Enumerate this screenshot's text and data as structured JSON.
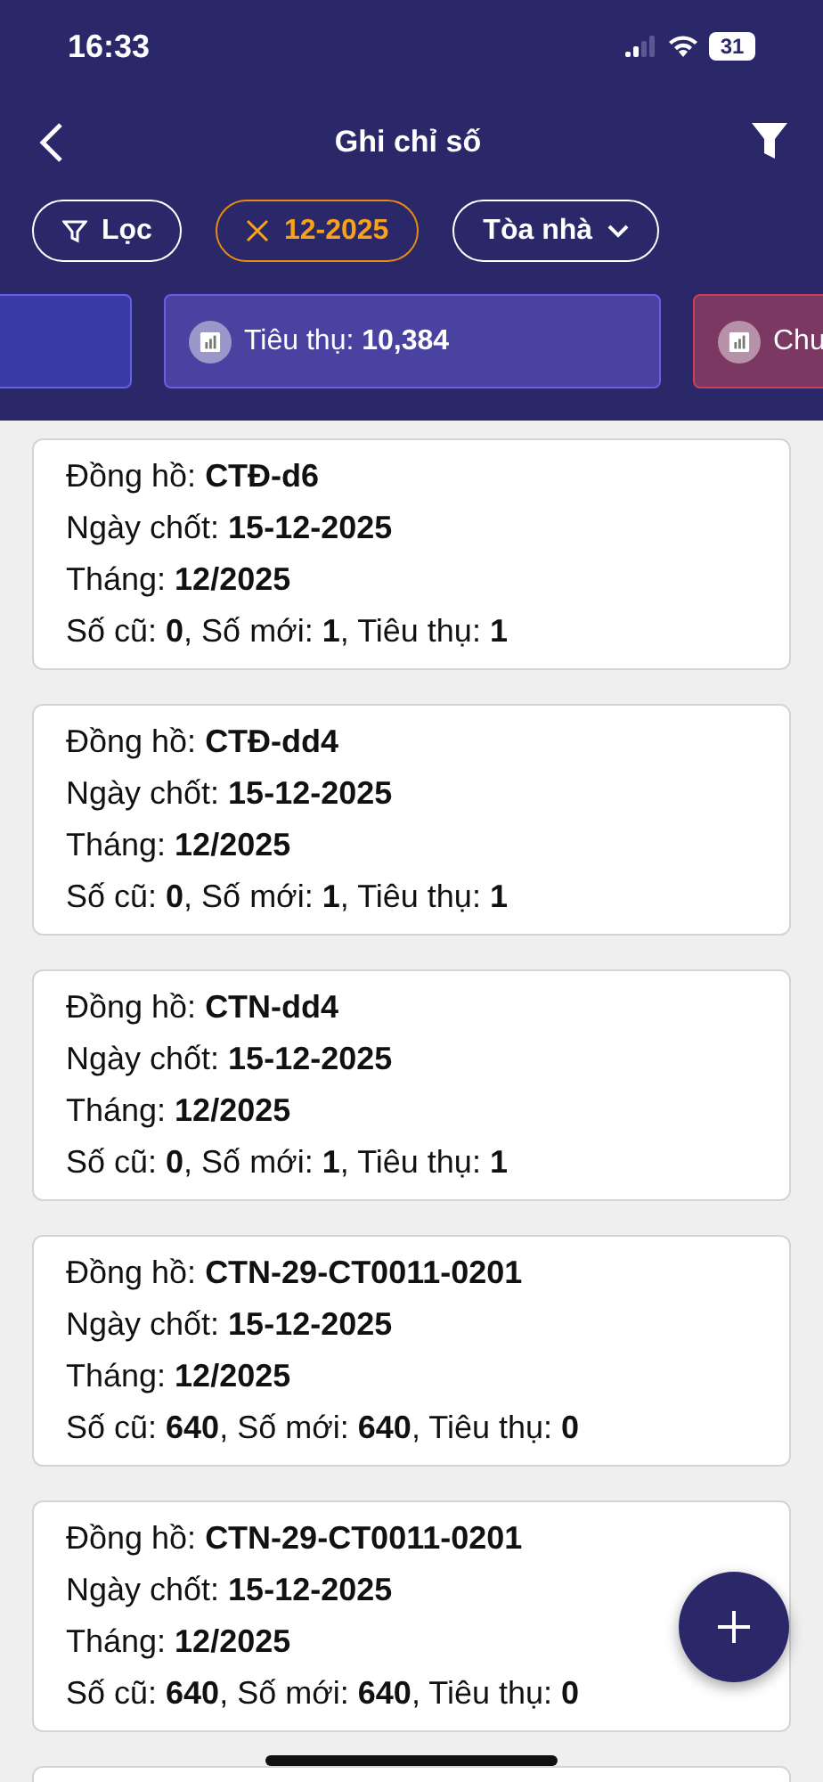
{
  "status_bar": {
    "time": "16:33",
    "battery": "31"
  },
  "header": {
    "title": "Ghi chỉ số"
  },
  "chips": [
    {
      "kind": "filter",
      "label": "Lọc",
      "active": false
    },
    {
      "kind": "clear",
      "label": "12-2025",
      "active": true
    },
    {
      "kind": "dropdown",
      "label": "Tòa nhà",
      "active": false
    }
  ],
  "stats": [
    {
      "color": "#3a3aa6"
    },
    {
      "label": "Tiêu thụ:",
      "value": "10,384",
      "color": "#4a42a0"
    },
    {
      "label": "Chu",
      "color": "#7a3862"
    }
  ],
  "cards": [
    {
      "lines": [
        "Đồng hồ: **CTĐ-d6**",
        "Ngày chốt: **15-12-2025**",
        "Tháng: **12/2025**",
        "Số cũ: **0**, Số mới: **1**, Tiêu thụ: **1**"
      ]
    },
    {
      "lines": [
        "Đồng hồ: **CTĐ-dd4**",
        "Ngày chốt: **15-12-2025**",
        "Tháng: **12/2025**",
        "Số cũ: **0**, Số mới: **1**, Tiêu thụ: **1**"
      ]
    },
    {
      "lines": [
        "Đồng hồ: **CTN-dd4**",
        "Ngày chốt: **15-12-2025**",
        "Tháng: **12/2025**",
        "Số cũ: **0**, Số mới: **1**, Tiêu thụ: **1**"
      ]
    },
    {
      "lines": [
        "Đồng hồ: **CTN-29-CT0011-0201**",
        "Ngày chốt: **15-12-2025**",
        "Tháng: **12/2025**",
        "Số cũ: **640**, Số mới: **640**, Tiêu thụ: **0**"
      ]
    },
    {
      "lines": [
        "Đồng hồ: **CTN-29-CT0011-0201**",
        "Ngày chốt: **15-12-2025**",
        "Tháng: **12/2025**",
        "Số cũ: **640**, Số mới: **640**, Tiêu thụ: **0**"
      ]
    }
  ]
}
